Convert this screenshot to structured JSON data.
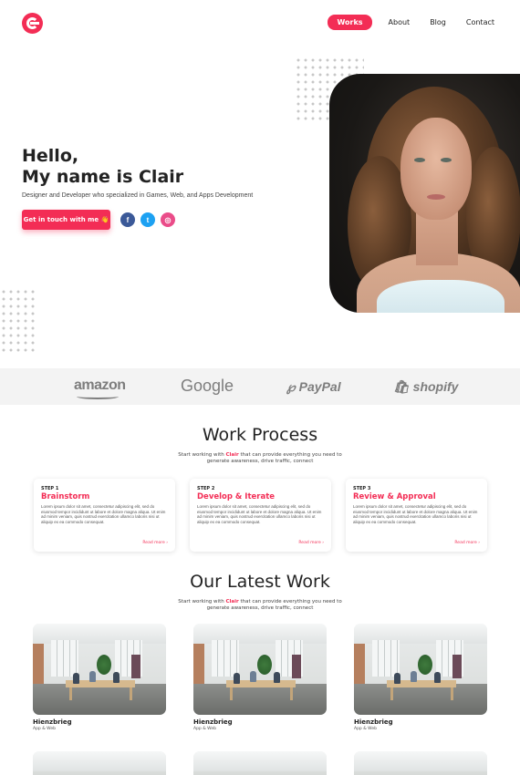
{
  "nav": {
    "items": [
      {
        "label": "Works",
        "active": true
      },
      {
        "label": "About",
        "active": false
      },
      {
        "label": "Blog",
        "active": false
      },
      {
        "label": "Contact",
        "active": false
      }
    ]
  },
  "hero": {
    "title_line1": "Hello,",
    "title_line2": "My name is Clair",
    "subtitle": "Designer and Developer who specialized in Games, Web, and Apps Development",
    "cta_label": "Get in touch with me 👋",
    "social": [
      {
        "icon": "facebook-icon",
        "glyph": "f",
        "color": "#3b5998"
      },
      {
        "icon": "twitter-icon",
        "glyph": "t",
        "color": "#1da1f2"
      },
      {
        "icon": "dribbble-icon",
        "glyph": "◎",
        "color": "#ea4c89"
      }
    ]
  },
  "brands": [
    "amazon",
    "Google",
    "PayPal",
    "shopify"
  ],
  "process": {
    "title": "Work Process",
    "subtitle_pre": "Start working with ",
    "subtitle_name": "Clair",
    "subtitle_post": " that can provide everything you need to generate awareness, drive traffic, connect",
    "steps": [
      {
        "step": "STEP 1",
        "title": "Brainstorm",
        "body": "Lorem ipsum dolor sit amet, consectetur adipiscing elit, sed do eiusmod tempor incididunt ut labore et dolore magna aliqua. Ut enim ad minim veniam, quis nostrud exercitation ullamco laboris nisi ut aliquip ex ea commodo consequat.",
        "more": "Read more ›"
      },
      {
        "step": "STEP 2",
        "title": "Develop & Iterate",
        "body": "Lorem ipsum dolor sit amet, consectetur adipiscing elit, sed do eiusmod tempor incididunt ut labore et dolore magna aliqua. Ut enim ad minim veniam, quis nostrud exercitation ullamco laboris nisi ut aliquip ex ea commodo consequat.",
        "more": "Read more ›"
      },
      {
        "step": "STEP 3",
        "title": "Review & Approval",
        "body": "Lorem ipsum dolor sit amet, consectetur adipiscing elit, sed do eiusmod tempor incididunt ut labore et dolore magna aliqua. Ut enim ad minim veniam, quis nostrud exercitation ullamco laboris nisi ut aliquip ex ea commodo consequat.",
        "more": "Read more ›"
      }
    ]
  },
  "latest": {
    "title": "Our Latest Work",
    "subtitle_pre": "Start working with ",
    "subtitle_name": "Clair",
    "subtitle_post": " that can provide everything you need to generate awareness, drive traffic, connect",
    "items": [
      {
        "name": "Hienzbrieg",
        "category": "App & Web"
      },
      {
        "name": "Hienzbrieg",
        "category": "App & Web"
      },
      {
        "name": "Hienzbrieg",
        "category": "App & Web"
      }
    ]
  },
  "colors": {
    "accent": "#f32d55",
    "brand_strip": "#f3f3f3"
  }
}
